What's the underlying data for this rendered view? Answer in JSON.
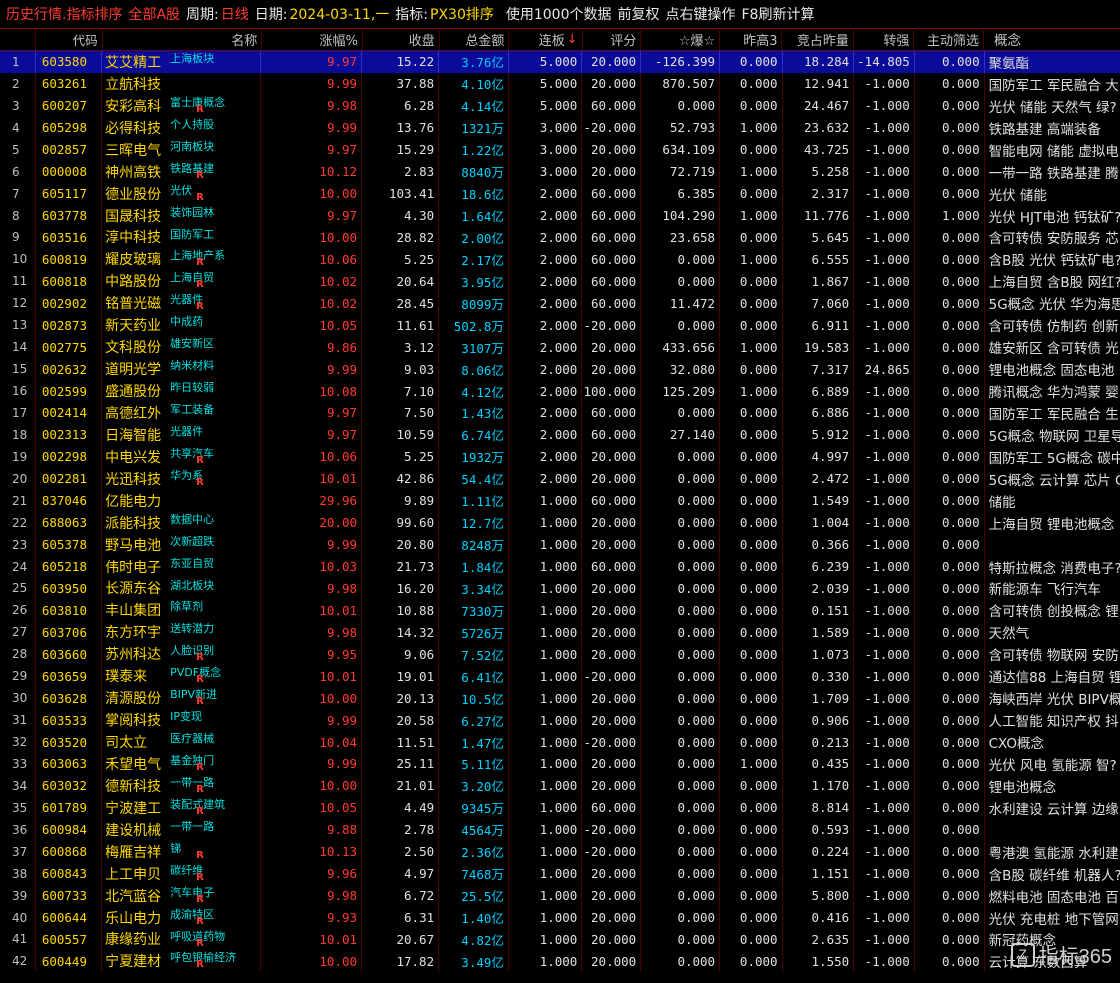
{
  "titlebar": {
    "t1": "历史行情.指标排序",
    "t2": "全部A股",
    "t3": "周期:",
    "t4": "日线",
    "t5": "日期:",
    "t6": "2024-03-11,一",
    "t7": "指标:",
    "t8": "PX30排序",
    "t9": "使用1000个数据",
    "t10": "前复权",
    "t11": "点右键操作",
    "t12": "F8刷新计算"
  },
  "columns": {
    "idx": "",
    "code": "代码",
    "name": "名称",
    "pct": "涨幅%",
    "close": "收盘",
    "amount": "总金额",
    "lianban": "连板",
    "score": "评分",
    "bao": "☆爆☆",
    "zuogao": "昨高3",
    "jingzhan": "竞占昨量",
    "zhuanqiang": "转强",
    "zhudong": "主动筛选",
    "gainian": "概念",
    "sort_arrow": "↓"
  },
  "rows": [
    {
      "i": "1",
      "code": "603580",
      "name": "艾艾精工",
      "tag": "上海板块",
      "r": "",
      "pct": "9.97",
      "close": "15.22",
      "amt": "3.76亿",
      "lb": "5.000",
      "ps": "20.000",
      "bz": "-126.399",
      "zg": "0.000",
      "jz": "18.284",
      "zq": "-14.805",
      "zd": "0.000",
      "gn": "聚氨酯"
    },
    {
      "i": "2",
      "code": "603261",
      "name": "立航科技",
      "tag": "",
      "r": "",
      "pct": "9.99",
      "close": "37.88",
      "amt": "4.10亿",
      "lb": "5.000",
      "ps": "20.000",
      "bz": "870.507",
      "zg": "0.000",
      "jz": "12.941",
      "zq": "-1.000",
      "zd": "0.000",
      "gn": "国防军工 军民融合 大"
    },
    {
      "i": "3",
      "code": "600207",
      "name": "安彩高科",
      "tag": "富士康概念",
      "r": "R",
      "pct": "9.98",
      "close": "6.28",
      "amt": "4.14亿",
      "lb": "5.000",
      "ps": "60.000",
      "bz": "0.000",
      "zg": "0.000",
      "jz": "24.467",
      "zq": "-1.000",
      "zd": "0.000",
      "gn": "光伏 储能 天然气 绿?"
    },
    {
      "i": "4",
      "code": "605298",
      "name": "必得科技",
      "tag": "个人持股",
      "r": "",
      "pct": "9.99",
      "close": "13.76",
      "amt": "1321万",
      "lb": "3.000",
      "ps": "-20.000",
      "bz": "52.793",
      "zg": "1.000",
      "jz": "23.632",
      "zq": "-1.000",
      "zd": "0.000",
      "gn": "铁路基建 高端装备"
    },
    {
      "i": "5",
      "code": "002857",
      "name": "三晖电气",
      "tag": "河南板块",
      "r": "",
      "pct": "9.97",
      "close": "15.29",
      "amt": "1.22亿",
      "lb": "3.000",
      "ps": "20.000",
      "bz": "634.109",
      "zg": "0.000",
      "jz": "43.725",
      "zq": "-1.000",
      "zd": "0.000",
      "gn": "智能电网 储能 虚拟电"
    },
    {
      "i": "6",
      "code": "000008",
      "name": "神州高铁",
      "tag": "铁路基建",
      "r": "R",
      "pct": "10.12",
      "close": "2.83",
      "amt": "8840万",
      "lb": "3.000",
      "ps": "20.000",
      "bz": "72.719",
      "zg": "1.000",
      "jz": "5.258",
      "zq": "-1.000",
      "zd": "0.000",
      "gn": "一带一路 铁路基建 腾"
    },
    {
      "i": "7",
      "code": "605117",
      "name": "德业股份",
      "tag": "光伏",
      "r": "R",
      "pct": "10.00",
      "close": "103.41",
      "amt": "18.6亿",
      "lb": "2.000",
      "ps": "60.000",
      "bz": "6.385",
      "zg": "0.000",
      "jz": "2.317",
      "zq": "-1.000",
      "zd": "0.000",
      "gn": "光伏 储能"
    },
    {
      "i": "8",
      "code": "603778",
      "name": "国晟科技",
      "tag": "装饰园林",
      "r": "",
      "pct": "9.97",
      "close": "4.30",
      "amt": "1.64亿",
      "lb": "2.000",
      "ps": "60.000",
      "bz": "104.290",
      "zg": "1.000",
      "jz": "11.776",
      "zq": "-1.000",
      "zd": "1.000",
      "gn": "光伏 HJT电池 钙钛矿?"
    },
    {
      "i": "9",
      "code": "603516",
      "name": "淳中科技",
      "tag": "国防军工",
      "r": "",
      "pct": "10.00",
      "close": "28.82",
      "amt": "2.00亿",
      "lb": "2.000",
      "ps": "60.000",
      "bz": "23.658",
      "zg": "0.000",
      "jz": "5.645",
      "zq": "-1.000",
      "zd": "0.000",
      "gn": "含可转债 安防服务 芯"
    },
    {
      "i": "10",
      "code": "600819",
      "name": "耀皮玻璃",
      "tag": "上海地产系",
      "r": "R",
      "pct": "10.06",
      "close": "5.25",
      "amt": "2.17亿",
      "lb": "2.000",
      "ps": "60.000",
      "bz": "0.000",
      "zg": "1.000",
      "jz": "6.555",
      "zq": "-1.000",
      "zd": "0.000",
      "gn": "含B股 光伏 钙钛矿电?"
    },
    {
      "i": "11",
      "code": "600818",
      "name": "中路股份",
      "tag": "上海自贸",
      "r": "R",
      "pct": "10.02",
      "close": "20.64",
      "amt": "3.95亿",
      "lb": "2.000",
      "ps": "60.000",
      "bz": "0.000",
      "zg": "0.000",
      "jz": "1.867",
      "zq": "-1.000",
      "zd": "0.000",
      "gn": "上海自贸 含B股 网红?"
    },
    {
      "i": "12",
      "code": "002902",
      "name": "铭普光磁",
      "tag": "光器件",
      "r": "R",
      "pct": "10.02",
      "close": "28.45",
      "amt": "8099万",
      "lb": "2.000",
      "ps": "60.000",
      "bz": "11.472",
      "zg": "0.000",
      "jz": "7.060",
      "zq": "-1.000",
      "zd": "0.000",
      "gn": "5G概念 光伏 华为海思"
    },
    {
      "i": "13",
      "code": "002873",
      "name": "新天药业",
      "tag": "中成药",
      "r": "",
      "pct": "10.05",
      "close": "11.61",
      "amt": "502.8万",
      "lb": "2.000",
      "ps": "-20.000",
      "bz": "0.000",
      "zg": "0.000",
      "jz": "6.911",
      "zq": "-1.000",
      "zd": "0.000",
      "gn": "含可转债 仿制药 创新"
    },
    {
      "i": "14",
      "code": "002775",
      "name": "文科股份",
      "tag": "雄安新区",
      "r": "",
      "pct": "9.86",
      "close": "3.12",
      "amt": "3107万",
      "lb": "2.000",
      "ps": "20.000",
      "bz": "433.656",
      "zg": "1.000",
      "jz": "19.583",
      "zq": "-1.000",
      "zd": "0.000",
      "gn": "雄安新区 含可转债 光"
    },
    {
      "i": "15",
      "code": "002632",
      "name": "道明光学",
      "tag": "纳米材料",
      "r": "",
      "pct": "9.99",
      "close": "9.03",
      "amt": "8.06亿",
      "lb": "2.000",
      "ps": "20.000",
      "bz": "32.080",
      "zg": "0.000",
      "jz": "7.317",
      "zq": "24.865",
      "zd": "0.000",
      "gn": "锂电池概念 固态电池"
    },
    {
      "i": "16",
      "code": "002599",
      "name": "盛通股份",
      "tag": "昨日较弱",
      "r": "",
      "pct": "10.08",
      "close": "7.10",
      "amt": "4.12亿",
      "lb": "2.000",
      "ps": "100.000",
      "bz": "125.209",
      "zg": "1.000",
      "jz": "6.889",
      "zq": "-1.000",
      "zd": "0.000",
      "gn": "腾讯概念 华为鸿蒙 婴"
    },
    {
      "i": "17",
      "code": "002414",
      "name": "高德红外",
      "tag": "军工装备",
      "r": "",
      "pct": "9.97",
      "close": "7.50",
      "amt": "1.43亿",
      "lb": "2.000",
      "ps": "60.000",
      "bz": "0.000",
      "zg": "0.000",
      "jz": "6.886",
      "zq": "-1.000",
      "zd": "0.000",
      "gn": "国防军工 军民融合 生"
    },
    {
      "i": "18",
      "code": "002313",
      "name": "日海智能",
      "tag": "光器件",
      "r": "",
      "pct": "9.97",
      "close": "10.59",
      "amt": "6.74亿",
      "lb": "2.000",
      "ps": "60.000",
      "bz": "27.140",
      "zg": "0.000",
      "jz": "5.912",
      "zq": "-1.000",
      "zd": "0.000",
      "gn": "5G概念 物联网 卫星导"
    },
    {
      "i": "19",
      "code": "002298",
      "name": "中电兴发",
      "tag": "共享汽车",
      "r": "R",
      "pct": "10.06",
      "close": "5.25",
      "amt": "1932万",
      "lb": "2.000",
      "ps": "20.000",
      "bz": "0.000",
      "zg": "0.000",
      "jz": "4.997",
      "zq": "-1.000",
      "zd": "0.000",
      "gn": "国防军工 5G概念 碳中"
    },
    {
      "i": "20",
      "code": "002281",
      "name": "光迅科技",
      "tag": "华为系",
      "r": "R",
      "pct": "10.01",
      "close": "42.86",
      "amt": "54.4亿",
      "lb": "2.000",
      "ps": "20.000",
      "bz": "0.000",
      "zg": "0.000",
      "jz": "2.472",
      "zq": "-1.000",
      "zd": "0.000",
      "gn": "5G概念 云计算 芯片 C"
    },
    {
      "i": "21",
      "code": "837046",
      "name": "亿能电力",
      "tag": "",
      "r": "",
      "pct": "29.96",
      "close": "9.89",
      "amt": "1.11亿",
      "lb": "1.000",
      "ps": "60.000",
      "bz": "0.000",
      "zg": "0.000",
      "jz": "1.549",
      "zq": "-1.000",
      "zd": "0.000",
      "gn": "储能"
    },
    {
      "i": "22",
      "code": "688063",
      "name": "派能科技",
      "tag": "数据中心",
      "r": "",
      "pct": "20.00",
      "close": "99.60",
      "amt": "12.7亿",
      "lb": "1.000",
      "ps": "20.000",
      "bz": "0.000",
      "zg": "0.000",
      "jz": "1.004",
      "zq": "-1.000",
      "zd": "0.000",
      "gn": "上海自贸 锂电池概念"
    },
    {
      "i": "23",
      "code": "605378",
      "name": "野马电池",
      "tag": "次新超跌",
      "r": "",
      "pct": "9.99",
      "close": "20.80",
      "amt": "8248万",
      "lb": "1.000",
      "ps": "20.000",
      "bz": "0.000",
      "zg": "0.000",
      "jz": "0.366",
      "zq": "-1.000",
      "zd": "0.000",
      "gn": ""
    },
    {
      "i": "24",
      "code": "605218",
      "name": "伟时电子",
      "tag": "东亚自贸",
      "r": "",
      "pct": "10.03",
      "close": "21.73",
      "amt": "1.84亿",
      "lb": "1.000",
      "ps": "60.000",
      "bz": "0.000",
      "zg": "0.000",
      "jz": "6.239",
      "zq": "-1.000",
      "zd": "0.000",
      "gn": "特斯拉概念 消费电子?"
    },
    {
      "i": "25",
      "code": "603950",
      "name": "长源东谷",
      "tag": "湖北板块",
      "r": "",
      "pct": "9.98",
      "close": "16.20",
      "amt": "3.34亿",
      "lb": "1.000",
      "ps": "20.000",
      "bz": "0.000",
      "zg": "0.000",
      "jz": "2.039",
      "zq": "-1.000",
      "zd": "0.000",
      "gn": "新能源车 飞行汽车"
    },
    {
      "i": "26",
      "code": "603810",
      "name": "丰山集团",
      "tag": "除草剂",
      "r": "",
      "pct": "10.01",
      "close": "10.88",
      "amt": "7330万",
      "lb": "1.000",
      "ps": "20.000",
      "bz": "0.000",
      "zg": "0.000",
      "jz": "0.151",
      "zq": "-1.000",
      "zd": "0.000",
      "gn": "含可转债 创投概念 锂"
    },
    {
      "i": "27",
      "code": "603706",
      "name": "东方环宇",
      "tag": "送转潜力",
      "r": "",
      "pct": "9.98",
      "close": "14.32",
      "amt": "5726万",
      "lb": "1.000",
      "ps": "20.000",
      "bz": "0.000",
      "zg": "0.000",
      "jz": "1.589",
      "zq": "-1.000",
      "zd": "0.000",
      "gn": "天然气"
    },
    {
      "i": "28",
      "code": "603660",
      "name": "苏州科达",
      "tag": "人脸识别",
      "r": "R",
      "pct": "9.95",
      "close": "9.06",
      "amt": "7.52亿",
      "lb": "1.000",
      "ps": "20.000",
      "bz": "0.000",
      "zg": "0.000",
      "jz": "1.073",
      "zq": "-1.000",
      "zd": "0.000",
      "gn": "含可转债 物联网 安防"
    },
    {
      "i": "29",
      "code": "603659",
      "name": "璞泰来",
      "tag": "PVDF概念",
      "r": "R",
      "pct": "10.01",
      "close": "19.01",
      "amt": "6.41亿",
      "lb": "1.000",
      "ps": "-20.000",
      "bz": "0.000",
      "zg": "0.000",
      "jz": "0.330",
      "zq": "-1.000",
      "zd": "0.000",
      "gn": "通达信88 上海自贸 锂"
    },
    {
      "i": "30",
      "code": "603628",
      "name": "清源股份",
      "tag": "BIPV新进",
      "r": "R",
      "pct": "10.00",
      "close": "20.13",
      "amt": "10.5亿",
      "lb": "1.000",
      "ps": "20.000",
      "bz": "0.000",
      "zg": "0.000",
      "jz": "1.709",
      "zq": "-1.000",
      "zd": "0.000",
      "gn": "海峡西岸 光伏 BIPV概"
    },
    {
      "i": "31",
      "code": "603533",
      "name": "掌阅科技",
      "tag": "IP变现",
      "r": "",
      "pct": "9.99",
      "close": "20.58",
      "amt": "6.27亿",
      "lb": "1.000",
      "ps": "20.000",
      "bz": "0.000",
      "zg": "0.000",
      "jz": "0.906",
      "zq": "-1.000",
      "zd": "0.000",
      "gn": "人工智能 知识产权 抖"
    },
    {
      "i": "32",
      "code": "603520",
      "name": "司太立",
      "tag": "医疗器械",
      "r": "",
      "pct": "10.04",
      "close": "11.51",
      "amt": "1.47亿",
      "lb": "1.000",
      "ps": "-20.000",
      "bz": "0.000",
      "zg": "0.000",
      "jz": "0.213",
      "zq": "-1.000",
      "zd": "0.000",
      "gn": "CXO概念"
    },
    {
      "i": "33",
      "code": "603063",
      "name": "禾望电气",
      "tag": "基金独门",
      "r": "R",
      "pct": "9.99",
      "close": "25.11",
      "amt": "5.11亿",
      "lb": "1.000",
      "ps": "20.000",
      "bz": "0.000",
      "zg": "1.000",
      "jz": "0.435",
      "zq": "-1.000",
      "zd": "0.000",
      "gn": "光伏 风电 氢能源 智?"
    },
    {
      "i": "34",
      "code": "603032",
      "name": "德新科技",
      "tag": "一带一路",
      "r": "R",
      "pct": "10.00",
      "close": "21.01",
      "amt": "3.20亿",
      "lb": "1.000",
      "ps": "20.000",
      "bz": "0.000",
      "zg": "0.000",
      "jz": "1.170",
      "zq": "-1.000",
      "zd": "0.000",
      "gn": "锂电池概念"
    },
    {
      "i": "35",
      "code": "601789",
      "name": "宁波建工",
      "tag": "装配式建筑",
      "r": "R",
      "pct": "10.05",
      "close": "4.49",
      "amt": "9345万",
      "lb": "1.000",
      "ps": "60.000",
      "bz": "0.000",
      "zg": "0.000",
      "jz": "8.814",
      "zq": "-1.000",
      "zd": "0.000",
      "gn": "水利建设 云计算 边缘"
    },
    {
      "i": "36",
      "code": "600984",
      "name": "建设机械",
      "tag": "一带一路",
      "r": "",
      "pct": "9.88",
      "close": "2.78",
      "amt": "4564万",
      "lb": "1.000",
      "ps": "-20.000",
      "bz": "0.000",
      "zg": "0.000",
      "jz": "0.593",
      "zq": "-1.000",
      "zd": "0.000",
      "gn": ""
    },
    {
      "i": "37",
      "code": "600868",
      "name": "梅雁吉祥",
      "tag": "锑",
      "r": "R",
      "pct": "10.13",
      "close": "2.50",
      "amt": "2.36亿",
      "lb": "1.000",
      "ps": "-20.000",
      "bz": "0.000",
      "zg": "0.000",
      "jz": "0.224",
      "zq": "-1.000",
      "zd": "0.000",
      "gn": "粤港澳 氢能源 水利建"
    },
    {
      "i": "38",
      "code": "600843",
      "name": "上工申贝",
      "tag": "碳纤维",
      "r": "R",
      "pct": "9.96",
      "close": "4.97",
      "amt": "7468万",
      "lb": "1.000",
      "ps": "20.000",
      "bz": "0.000",
      "zg": "0.000",
      "jz": "1.151",
      "zq": "-1.000",
      "zd": "0.000",
      "gn": "含B股 碳纤维 机器人?"
    },
    {
      "i": "39",
      "code": "600733",
      "name": "北汽蓝谷",
      "tag": "汽车电子",
      "r": "R",
      "pct": "9.98",
      "close": "6.72",
      "amt": "25.5亿",
      "lb": "1.000",
      "ps": "20.000",
      "bz": "0.000",
      "zg": "0.000",
      "jz": "5.800",
      "zq": "-1.000",
      "zd": "0.000",
      "gn": "燃料电池 固态电池 百"
    },
    {
      "i": "40",
      "code": "600644",
      "name": "乐山电力",
      "tag": "成渝特区",
      "r": "R",
      "pct": "9.93",
      "close": "6.31",
      "amt": "1.40亿",
      "lb": "1.000",
      "ps": "20.000",
      "bz": "0.000",
      "zg": "0.000",
      "jz": "0.416",
      "zq": "-1.000",
      "zd": "0.000",
      "gn": "光伏 充电桩 地下管网"
    },
    {
      "i": "41",
      "code": "600557",
      "name": "康缘药业",
      "tag": "呼吸道药物",
      "r": "R",
      "pct": "10.01",
      "close": "20.67",
      "amt": "4.82亿",
      "lb": "1.000",
      "ps": "20.000",
      "bz": "0.000",
      "zg": "0.000",
      "jz": "2.635",
      "zq": "-1.000",
      "zd": "0.000",
      "gn": "新冠药概念"
    },
    {
      "i": "42",
      "code": "600449",
      "name": "宁夏建材",
      "tag": "呼包银榆经济",
      "r": "R",
      "pct": "10.00",
      "close": "17.82",
      "amt": "3.49亿",
      "lb": "1.000",
      "ps": "20.000",
      "bz": "0.000",
      "zg": "0.000",
      "jz": "1.550",
      "zq": "-1.000",
      "zd": "0.000",
      "gn": "云计算 东数西算"
    }
  ],
  "watermark": {
    "logo": "Z",
    "text": "指标365"
  },
  "colors": {
    "background": "#000000",
    "selected_row": "#0b0b9a",
    "up": "#ff3b30",
    "code": "#ffd700",
    "amount": "#00d0ff",
    "grid": "#4a0000"
  }
}
